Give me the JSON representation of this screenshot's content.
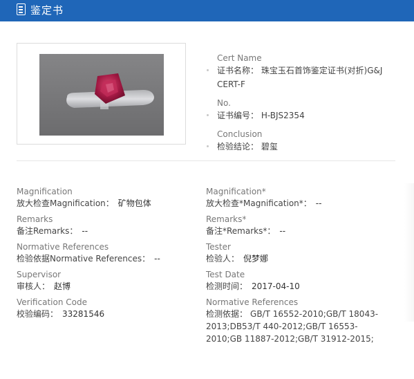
{
  "header": {
    "title": "鉴定书",
    "icon": "document-icon"
  },
  "cert": {
    "name_en": "Cert Name",
    "name_zh": "证书名称：",
    "name_value": "珠宝玉石首饰鉴定证书(对折)G&J CERT-F",
    "no_en": "No.",
    "no_zh": "证书编号：",
    "no_value": "H-BJS2354",
    "conclusion_en": "Conclusion",
    "conclusion_zh": "检验结论：",
    "conclusion_value": "碧玺"
  },
  "left": {
    "magnification_en": "Magnification",
    "magnification_zh": "放大检查Magnification：",
    "magnification_value": "矿物包体",
    "remarks_en": "Remarks",
    "remarks_zh": "备注Remarks：",
    "remarks_value": "--",
    "normative_en": "Normative References",
    "normative_zh": "检验依据Normative References：",
    "normative_value": "--",
    "supervisor_en": "Supervisor",
    "supervisor_zh": "审核人：",
    "supervisor_value": "赵博",
    "verification_en": "Verification Code",
    "verification_zh": "校验编码：",
    "verification_value": "33281546"
  },
  "right": {
    "magnification_en": "Magnification*",
    "magnification_zh": "放大检查*Magnification*：",
    "magnification_value": "--",
    "remarks_en": "Remarks*",
    "remarks_zh": "备注*Remarks*：",
    "remarks_value": "--",
    "tester_en": "Tester",
    "tester_zh": "检验人：",
    "tester_value": "倪梦娜",
    "testdate_en": "Test Date",
    "testdate_zh": "检测时间：",
    "testdate_value": "2017-04-10",
    "normative_en": "Normative References",
    "normative_zh": "检测依据：",
    "normative_value": "GB/T 16552-2010;GB/T 18043-2013;DB53/T 440-2012;GB/T 16553-2010;GB 11887-2012;GB/T 31912-2015;"
  }
}
